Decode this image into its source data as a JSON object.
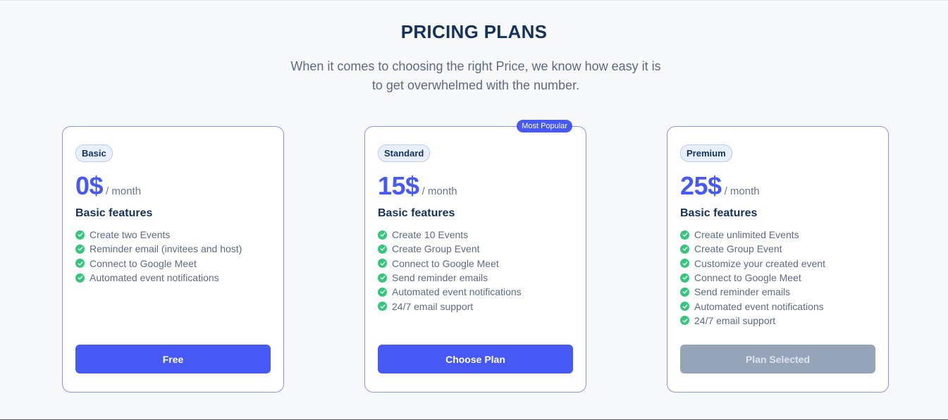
{
  "section": {
    "title": "PRICING PLANS",
    "subtitle": "When it comes to choosing the right Price, we know how easy it is to get overwhelmed with the number."
  },
  "colors": {
    "accent": "#4759f5",
    "check": "#34c77b",
    "disabled": "#96a4b9",
    "heading": "#15325f"
  },
  "plans": [
    {
      "badge": "Basic",
      "price": "0$",
      "period": "/ month",
      "features_title": "Basic features",
      "features": [
        "Create two Events",
        "Reminder email (invitees and host)",
        "Connect to Google Meet",
        "Automated event notifications"
      ],
      "button": "Free",
      "button_state": "primary"
    },
    {
      "ribbon": "Most Popular",
      "badge": "Standard",
      "price": "15$",
      "period": "/ month",
      "features_title": "Basic features",
      "features": [
        "Create 10 Events",
        "Create Group Event",
        "Connect to Google Meet",
        "Send reminder emails",
        "Automated event notifications",
        "24/7 email support"
      ],
      "button": "Choose Plan",
      "button_state": "primary"
    },
    {
      "badge": "Premium",
      "price": "25$",
      "period": "/ month",
      "features_title": "Basic features",
      "features": [
        "Create unlimited Events",
        "Create Group Event",
        "Customize your created event",
        "Connect to Google Meet",
        "Send reminder emails",
        "Automated event notifications",
        "24/7 email support"
      ],
      "button": "Plan Selected",
      "button_state": "disabled"
    }
  ]
}
